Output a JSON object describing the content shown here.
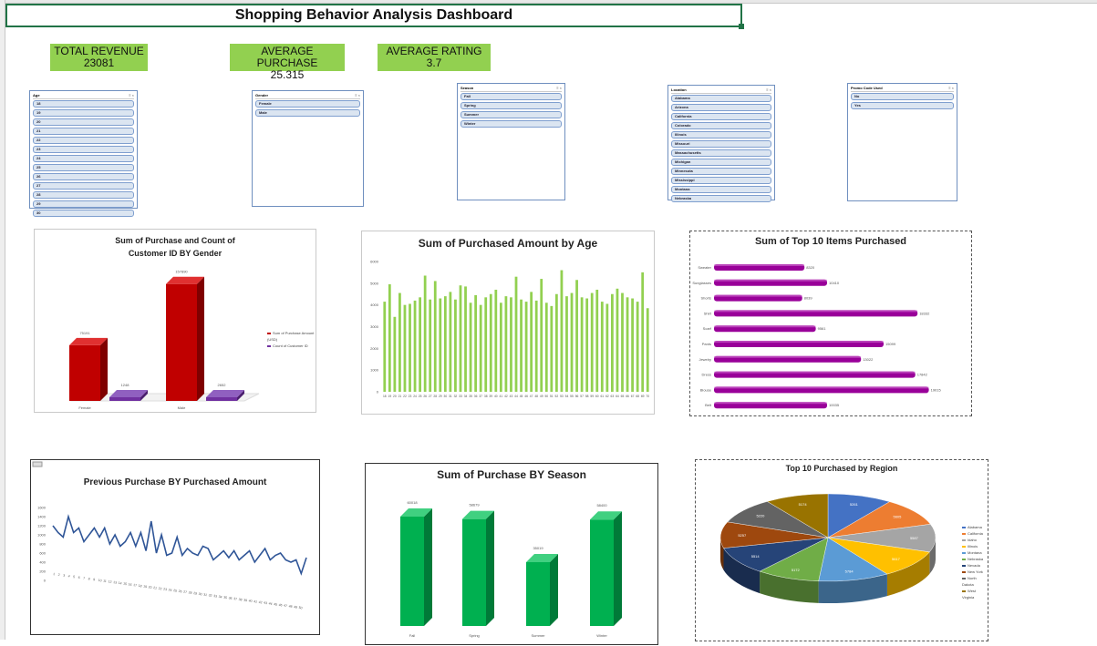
{
  "dashboard": {
    "title": "Shopping Behavior Analysis Dashboard"
  },
  "kpis": [
    {
      "label": "TOTAL REVENUE",
      "value": "23081"
    },
    {
      "label": "AVERAGE PURCHASE",
      "value": "25.315"
    },
    {
      "label": "AVERAGE RATING",
      "value": "3.7"
    }
  ],
  "slicers": [
    {
      "title": "Age",
      "items": [
        "18",
        "19",
        "20",
        "21",
        "22",
        "23",
        "24",
        "25",
        "26",
        "27",
        "28",
        "29",
        "30"
      ]
    },
    {
      "title": "Gender",
      "items": [
        "Female",
        "Male"
      ]
    },
    {
      "title": "Season",
      "items": [
        "Fall",
        "Spring",
        "Summer",
        "Winter"
      ]
    },
    {
      "title": "Location",
      "items": [
        "Alabama",
        "Arizona",
        "California",
        "Colorado",
        "Illinois",
        "Missouri",
        "Massachusetts",
        "Michigan",
        "Minnesota",
        "Mississippi",
        "Montana",
        "Nebraska"
      ]
    },
    {
      "title": "Promo Code Used",
      "items": [
        "No",
        "Yes"
      ]
    }
  ],
  "chart_data": [
    {
      "type": "bar",
      "title": "Sum of Purchase and Count of Customer ID BY Gender",
      "categories": [
        "Female",
        "Male"
      ],
      "series": [
        {
          "name": "Sum of Purchase Amount (USD)",
          "values": [
            75191,
            157890
          ]
        },
        {
          "name": "Count of Customer ID",
          "values": [
            1248,
            2652
          ]
        }
      ],
      "colors": [
        "#c00000",
        "#7030a0"
      ],
      "legend": "right"
    },
    {
      "type": "bar",
      "title": "Sum of Purchased Amount by Age",
      "categories": [
        "18",
        "19",
        "20",
        "21",
        "22",
        "23",
        "24",
        "25",
        "26",
        "27",
        "28",
        "29",
        "30",
        "31",
        "32",
        "33",
        "34",
        "35",
        "36",
        "37",
        "38",
        "39",
        "40",
        "41",
        "42",
        "43",
        "44",
        "45",
        "46",
        "47",
        "48",
        "49",
        "50",
        "51",
        "52",
        "53",
        "54",
        "55",
        "56",
        "57",
        "58",
        "59",
        "60",
        "61",
        "62",
        "63",
        "64",
        "65",
        "66",
        "67",
        "68",
        "69",
        "70"
      ],
      "values": [
        4150,
        4950,
        3450,
        4550,
        4000,
        4050,
        4200,
        4350,
        5350,
        4250,
        5100,
        4300,
        4400,
        4600,
        4250,
        4900,
        4850,
        4100,
        4450,
        4000,
        4350,
        4500,
        4700,
        4100,
        4400,
        4350,
        5300,
        4250,
        4150,
        4600,
        4200,
        5200,
        4100,
        3950,
        4500,
        5600,
        4400,
        4550,
        5150,
        4350,
        4300,
        4550,
        4700,
        4150,
        4050,
        4500,
        4750,
        4550,
        4350,
        4300,
        4150,
        5500,
        3850
      ],
      "ylim": [
        0,
        6000
      ],
      "yticks": [
        "0",
        "1000",
        "2000",
        "3000",
        "4000",
        "5000",
        "6000"
      ],
      "color": "#92d050"
    },
    {
      "type": "bar",
      "title": "Sum of Top 10 Items Purchased",
      "categories": [
        "Sweater",
        "Sunglasses",
        "Shorts",
        "Shirt",
        "Scarf",
        "Pants",
        "Jewelry",
        "Dress",
        "Blouse",
        "Belt"
      ],
      "values": [
        8000,
        10000,
        7800,
        18000,
        9000,
        15000,
        13000,
        17800,
        19000,
        10000
      ],
      "data_labels": [
        "8320",
        "10410",
        "8039",
        "18332",
        "9561",
        "15099",
        "13022",
        "17842",
        "19015",
        "10035"
      ],
      "color": "#990099"
    },
    {
      "type": "line",
      "title": "Previous Purchase BY Purchased Amount",
      "x": [
        "1",
        "2",
        "3",
        "4",
        "5",
        "6",
        "7",
        "8",
        "9",
        "10",
        "11",
        "12",
        "13",
        "14",
        "15",
        "16",
        "17",
        "18",
        "19",
        "20",
        "21",
        "22",
        "23",
        "24",
        "25",
        "26",
        "27",
        "28",
        "29",
        "30",
        "31",
        "32",
        "33",
        "34",
        "35",
        "36",
        "37",
        "38",
        "39",
        "40",
        "41",
        "42",
        "43",
        "44",
        "45",
        "46",
        "47",
        "48",
        "49",
        "50"
      ],
      "values": [
        1200,
        1050,
        950,
        1400,
        1050,
        1150,
        850,
        1000,
        1150,
        950,
        1150,
        800,
        1000,
        750,
        850,
        1050,
        750,
        1050,
        650,
        1300,
        600,
        1000,
        550,
        600,
        950,
        550,
        700,
        600,
        550,
        750,
        700,
        450,
        550,
        650,
        500,
        650,
        450,
        550,
        650,
        400,
        550,
        700,
        450,
        550,
        600,
        450,
        400,
        450,
        150,
        500
      ],
      "ylim": [
        0,
        1600
      ],
      "yticks": [
        "0",
        "200",
        "400",
        "600",
        "800",
        "1000",
        "1200",
        "1400",
        "1600"
      ],
      "color": "#2f5597"
    },
    {
      "type": "bar",
      "title": "Sum of Purchase BY Season",
      "categories": [
        "Fall",
        "Spring",
        "Summer",
        "Winter"
      ],
      "values": [
        60018,
        58679,
        35019,
        58400
      ],
      "data_labels": [
        "60018",
        "58679",
        "35019",
        "58400"
      ],
      "color": "#00b050"
    },
    {
      "type": "pie",
      "title": "Top 10 Purchased by Region",
      "categories": [
        "Alabama",
        "California",
        "Idaho",
        "Illinois",
        "Montana",
        "Nebraska",
        "Nevada",
        "New York",
        "North Dakota",
        "West Virginia"
      ],
      "values": [
        5261,
        5605,
        5587,
        5617,
        5784,
        5172,
        5514,
        5257,
        5220,
        5174
      ],
      "colors": [
        "#4472c4",
        "#ed7d31",
        "#a5a5a5",
        "#ffc000",
        "#5b9bd5",
        "#70ad47",
        "#264478",
        "#9e480e",
        "#636363",
        "#997300"
      ],
      "legend": "right"
    }
  ]
}
